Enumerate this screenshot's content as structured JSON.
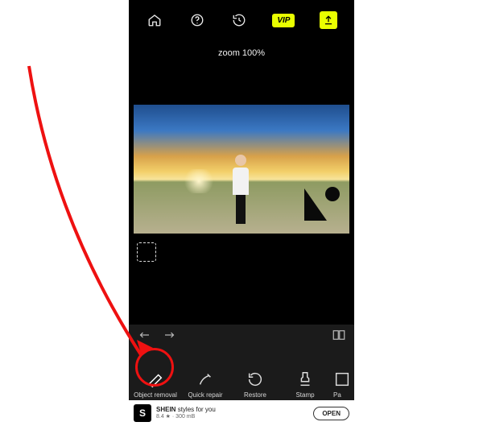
{
  "topbar": {
    "vip_label": "VIP"
  },
  "zoom": {
    "label": "zoom 100%"
  },
  "tools": {
    "object_removal": "Object removal",
    "quick_repair": "Quick repair",
    "restore": "Restore",
    "stamp": "Stamp",
    "partial_overflow": "Pa"
  },
  "ad": {
    "logo_letter": "S",
    "title": "SHEIN",
    "subtitle": "styles for you",
    "rating_line": "8.4 ★ · 300 mB",
    "open": "OPEN"
  }
}
